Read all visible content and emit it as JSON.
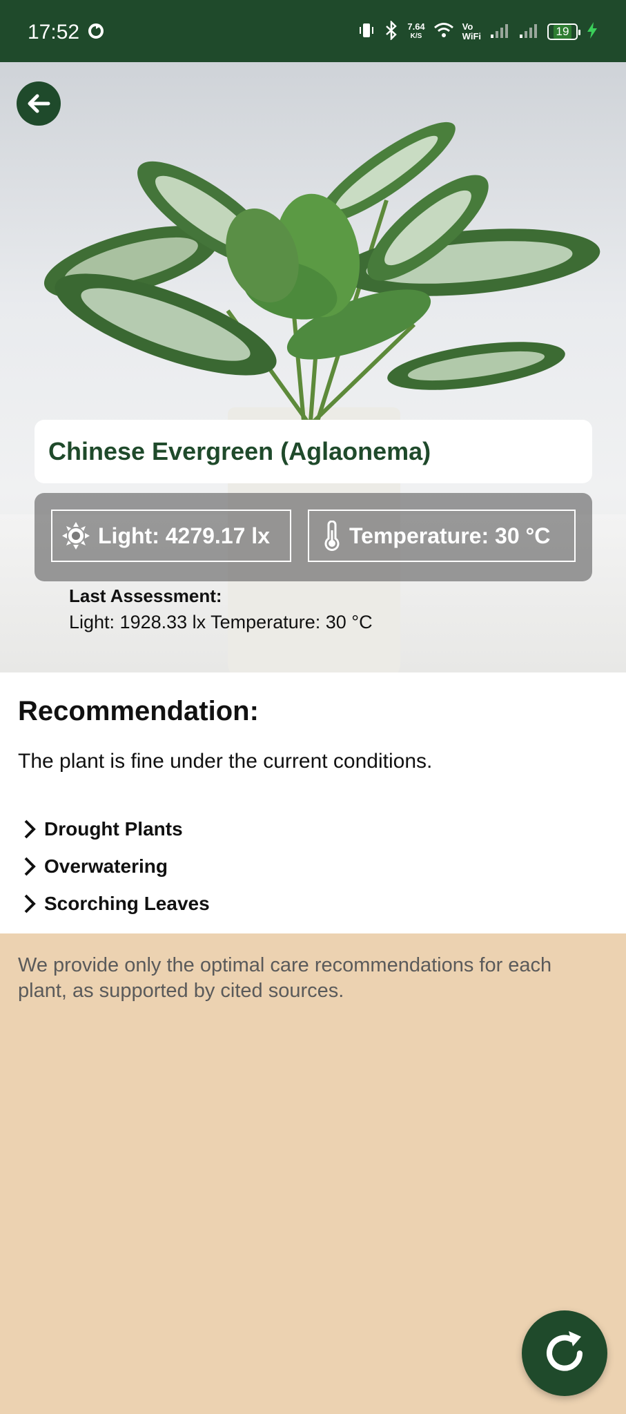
{
  "status_bar": {
    "time": "17:52",
    "speed_value": "7.64",
    "speed_unit": "K/S",
    "vowifi_top": "Vo",
    "vowifi_bottom": "WiFi",
    "battery": "19"
  },
  "plant": {
    "name": "Chinese Evergreen (Aglaonema)"
  },
  "sensors": {
    "light": "Light: 4279.17 lx",
    "temperature": "Temperature: 30 °C"
  },
  "last_assessment": {
    "title": "Last Assessment:",
    "values": "Light: 1928.33 lx Temperature: 30 °C"
  },
  "recommendation": {
    "heading": "Recommendation:",
    "text": "The plant is fine under the current conditions.",
    "topics": [
      "Drought Plants",
      "Overwatering",
      "Scorching Leaves"
    ]
  },
  "disclaimer": "We provide only the optimal care recommendations for each plant, as supported by cited sources.",
  "colors": {
    "primary": "#1f4a2b",
    "background": "#ecd2b1",
    "card": "#ffffff",
    "charging": "#3ad05a"
  },
  "icons": {
    "back": "arrow-left-icon",
    "light": "sun-icon",
    "temperature": "thermometer-icon",
    "refresh": "refresh-icon",
    "topic": "chevron-right-icon"
  }
}
